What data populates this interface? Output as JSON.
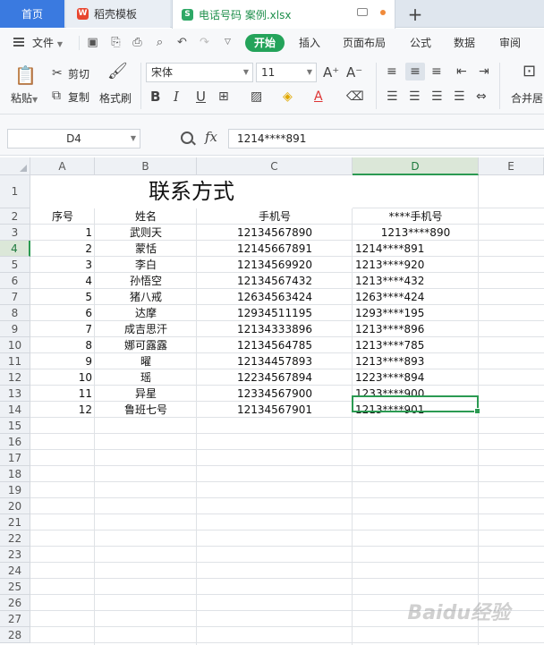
{
  "tabs": {
    "home": "首页",
    "template": "稻壳模板",
    "file": "电话号码 案例.xlsx",
    "plus": "+"
  },
  "menu": {
    "file": "文件",
    "start": "开始",
    "items": [
      "插入",
      "页面布局",
      "公式",
      "数据",
      "审阅"
    ]
  },
  "ribbon": {
    "paste": "粘贴",
    "cut": "剪切",
    "copy": "复制",
    "format_painter": "格式刷",
    "font_name": "宋体",
    "font_size": "11",
    "bold": "B",
    "italic": "I",
    "underline": "U",
    "font_grow": "A⁺",
    "font_shrink": "A⁻",
    "merge": "合并居"
  },
  "formula_bar": {
    "name_box": "D4",
    "fx": "fx",
    "value": "1214****891"
  },
  "sheet": {
    "columns": [
      "A",
      "B",
      "C",
      "D",
      "E"
    ],
    "title": "联系方式",
    "header": {
      "seq": "序号",
      "name": "姓名",
      "phone": "手机号",
      "masked": "****手机号"
    },
    "rows": [
      {
        "seq": "1",
        "name": "武则天",
        "phone": "12134567890",
        "masked": "1213****890"
      },
      {
        "seq": "2",
        "name": "蒙恬",
        "phone": "12145667891",
        "masked": "1214****891"
      },
      {
        "seq": "3",
        "name": "李白",
        "phone": "12134569920",
        "masked": "1213****920"
      },
      {
        "seq": "4",
        "name": "孙悟空",
        "phone": "12134567432",
        "masked": "1213****432"
      },
      {
        "seq": "5",
        "name": "猪八戒",
        "phone": "12634563424",
        "masked": "1263****424"
      },
      {
        "seq": "6",
        "name": "达摩",
        "phone": "12934511195",
        "masked": "1293****195"
      },
      {
        "seq": "7",
        "name": "成吉思汗",
        "phone": "12134333896",
        "masked": "1213****896"
      },
      {
        "seq": "8",
        "name": "娜可露露",
        "phone": "12134564785",
        "masked": "1213****785"
      },
      {
        "seq": "9",
        "name": "曜",
        "phone": "12134457893",
        "masked": "1213****893"
      },
      {
        "seq": "10",
        "name": "瑶",
        "phone": "12234567894",
        "masked": "1223****894"
      },
      {
        "seq": "11",
        "name": "异星",
        "phone": "12334567900",
        "masked": "1233****900"
      },
      {
        "seq": "12",
        "name": "鲁班七号",
        "phone": "12134567901",
        "masked": "1213****901"
      }
    ],
    "row_numbers": [
      "1",
      "2",
      "3",
      "4",
      "5",
      "6",
      "7",
      "8",
      "9",
      "10",
      "11",
      "12",
      "13",
      "14",
      "15",
      "16",
      "17",
      "18",
      "19",
      "20",
      "21",
      "22",
      "23",
      "24",
      "25",
      "26",
      "27",
      "28"
    ],
    "active_row": "4",
    "active_col": "D"
  },
  "watermark": "Baidu经验"
}
